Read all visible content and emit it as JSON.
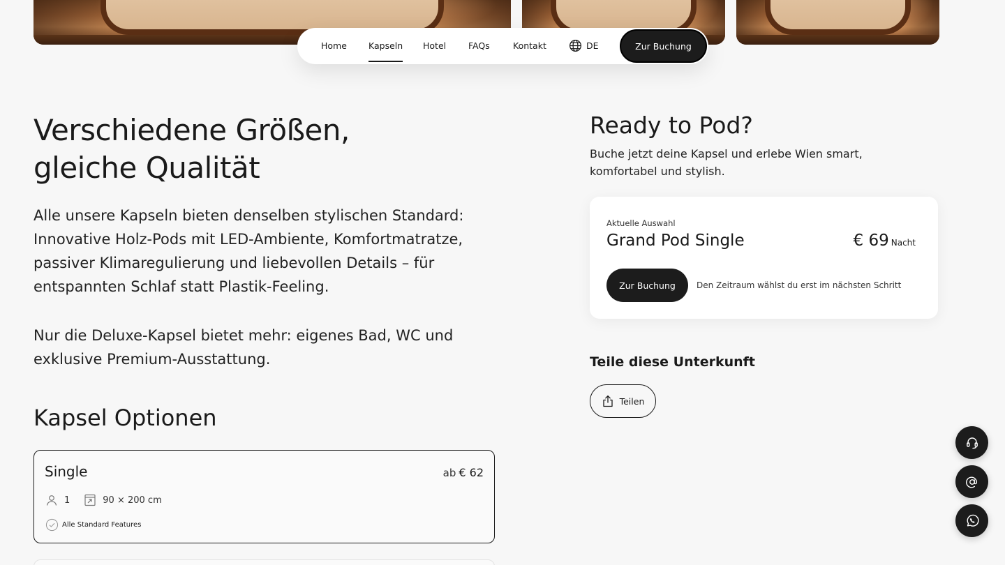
{
  "nav": {
    "items": [
      {
        "label": "Home",
        "active": false
      },
      {
        "label": "Kapseln",
        "active": true
      },
      {
        "label": "Hotel",
        "active": false
      },
      {
        "label": "FAQs",
        "active": false
      },
      {
        "label": "Kontakt",
        "active": false
      }
    ],
    "language": "DE",
    "cta_label": "Zur Buchung"
  },
  "intro": {
    "heading_line1": "Verschiedene Größen,",
    "heading_line2": "gleiche Qualität",
    "paragraph1": "Alle unsere Kapseln bieten denselben stylischen Standard: Innovative Holz-Pods mit LED-Ambiente, Komfortmatratze, passiver Klimaregulierung und liebevollen Details – für entspannten Schlaf statt Plastik-Feeling.",
    "paragraph2": "Nur die Deluxe-Kapsel bietet mehr: eigenes Bad, WC und exklusive Premium-Ausstattung."
  },
  "options": {
    "heading": "Kapsel Optionen",
    "cards": [
      {
        "name": "Single",
        "price_prefix": "ab",
        "price": "€ 62",
        "guests": "1",
        "size": "90 × 200 cm",
        "feature": "Alle Standard Features"
      }
    ]
  },
  "booking": {
    "title": "Ready to Pod?",
    "subtitle": "Buche jetzt deine Kapsel und erlebe Wien smart, komfortabel und stylish.",
    "selection_label": "Aktuelle Auswahl",
    "selection_name": "Grand Pod Single",
    "price": "€ 69",
    "price_unit": "Nacht",
    "cta_label": "Zur Buchung",
    "hint": "Den Zeitraum wählst du erst im nächsten Schritt"
  },
  "share": {
    "title": "Teile diese Unterkunft",
    "button_label": "Teilen"
  },
  "floating_buttons": [
    "headset-icon",
    "at-icon",
    "whatsapp-icon"
  ],
  "colors": {
    "background": "#f7f7f7",
    "dark": "#1c1c1c",
    "card": "#ffffff"
  }
}
